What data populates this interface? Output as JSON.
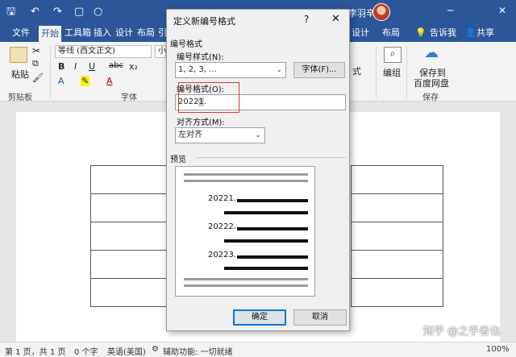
{
  "titlebar": {
    "user_name": "李羽辛",
    "minimize": "─",
    "close": "✕"
  },
  "ribbon_tabs": [
    "文件",
    "开始",
    "工具箱",
    "插入",
    "设计",
    "布局",
    "引",
    "设计",
    "布局",
    "告诉我",
    "共享"
  ],
  "ribbon": {
    "paste": "粘贴",
    "clipboard": "剪贴板",
    "font_name": "等线 (西文正文)",
    "font_size": "小",
    "bold": "B",
    "italic": "I",
    "underline": "U",
    "strike": "abc",
    "subscript": "x₂",
    "font_group": "字体",
    "numbering_label": "编组",
    "style_fragment": "式",
    "save_to": "保存到",
    "baidu": "百度网盘",
    "save_group": "保存"
  },
  "dialog": {
    "title": "定义新编号格式",
    "help": "?",
    "close": "✕",
    "section_format": "编号格式",
    "style_label": "编号样式(N):",
    "style_value": "1, 2, 3, ...",
    "font_button": "字体(F)...",
    "format_label": "编号格式(O):",
    "format_value_prefix": "2022",
    "format_value_field": "1",
    "format_value_suffix": ".",
    "align_label": "对齐方式(M):",
    "align_value": "左对齐",
    "preview_label": "预览",
    "preview_items": [
      "20221.",
      "20222.",
      "20223."
    ],
    "ok": "确定",
    "cancel": "取消"
  },
  "status": {
    "page": "第 1 页，共 1 页",
    "words": "0 个字",
    "language": "英语(美国)",
    "accessibility": "辅助功能: 一切就绪",
    "zoom": "100%"
  },
  "watermark": "知乎 @之乎者也",
  "colors": {
    "ribbon_blue": "#2b579a",
    "highlight_red": "#d9363e"
  }
}
